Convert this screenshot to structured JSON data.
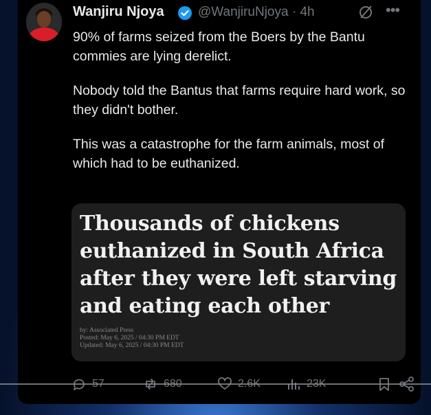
{
  "author": {
    "name": "Wanjiru Njoya",
    "handle": "@WanjiruNjoya · 4h"
  },
  "tweet": {
    "paragraphs": [
      "90% of farms seized from the Boers by the Bantu commies are lying derelict.",
      "Nobody told the Bantus that farms require hard work, so they didn't bother.",
      "This was a catastrophe for the farm animals, most of which had to be euthanized."
    ]
  },
  "card": {
    "headline": "Thousands of chickens euthanized in South Africa after they were left starving and eating each other",
    "byline": "by: Associated Press",
    "posted": "Posted: May 6, 2025 / 04:30 PM EDT",
    "updated": "Updated: May 6, 2025 / 04:30 PM EDT"
  },
  "actions": {
    "replies": "57",
    "reposts": "680",
    "likes": "2.6K",
    "views": "23K"
  },
  "icons": {
    "verified": "verified-badge-icon",
    "grok": "grok-icon",
    "more": "more-icon",
    "reply": "reply-icon",
    "repost": "repost-icon",
    "like": "like-icon",
    "views": "views-icon",
    "bookmark": "bookmark-icon",
    "share": "share-icon"
  },
  "colors": {
    "background": "#000000",
    "text": "#e7e9ea",
    "muted": "#71767b",
    "verified": "#1d9bf0",
    "card": "#1e1e1f"
  }
}
